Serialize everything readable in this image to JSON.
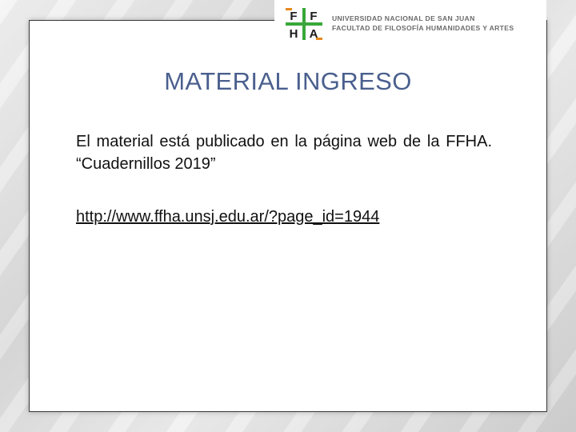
{
  "header": {
    "logo_letters": [
      "F",
      "F",
      "H",
      "A"
    ],
    "logo_colors": {
      "green": "#3aa63a",
      "orange": "#e8891c",
      "dark": "#1a1a1a"
    },
    "institution_line1": "UNIVERSIDAD NACIONAL DE SAN JUAN",
    "institution_line2": "FACULTAD DE FILOSOFÍA HUMANIDADES Y ARTES"
  },
  "slide": {
    "title": "MATERIAL INGRESO",
    "body": "El material está publicado en la página web de la FFHA. “Cuadernillos 2019”",
    "link": "http://www.ffha.unsj.edu.ar/?page_id=1944"
  },
  "colors": {
    "title": "#4a5f8e",
    "text": "#111111"
  }
}
